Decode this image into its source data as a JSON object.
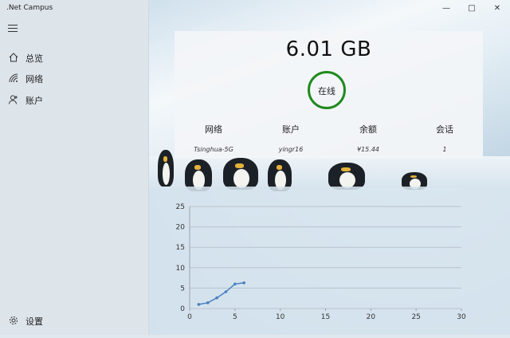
{
  "app": {
    "title": ".Net Campus"
  },
  "window_controls": {
    "minimize": "—",
    "maximize": "□",
    "close": "✕"
  },
  "sidebar": {
    "items": [
      {
        "label": "总览",
        "icon": "home-icon"
      },
      {
        "label": "网络",
        "icon": "wifi-icon"
      },
      {
        "label": "账户",
        "icon": "accounts-icon"
      }
    ],
    "settings": {
      "label": "设置",
      "icon": "gear-icon"
    }
  },
  "stats": {
    "usage": "6.01 GB",
    "status": "在线",
    "status_color": "#1e8a1e",
    "columns": [
      {
        "header": "网络",
        "value": "Tsinghua-5G"
      },
      {
        "header": "账户",
        "value": "yingr16"
      },
      {
        "header": "余额",
        "value": "¥15.44"
      },
      {
        "header": "会话",
        "value": "1"
      }
    ]
  },
  "chart_data": {
    "type": "line",
    "title": "",
    "xlabel": "",
    "ylabel": "",
    "xlim": [
      0,
      30
    ],
    "ylim": [
      0,
      25
    ],
    "xticks": [
      0,
      5,
      10,
      15,
      20,
      25,
      30
    ],
    "yticks": [
      0,
      5,
      10,
      15,
      20,
      25
    ],
    "grid": "horizontal",
    "series": [
      {
        "color": "#4a7fc0",
        "x": [
          1,
          2,
          3,
          4,
          5,
          6
        ],
        "y": [
          1.0,
          1.4,
          2.6,
          4.1,
          6.0,
          6.3
        ]
      }
    ]
  }
}
